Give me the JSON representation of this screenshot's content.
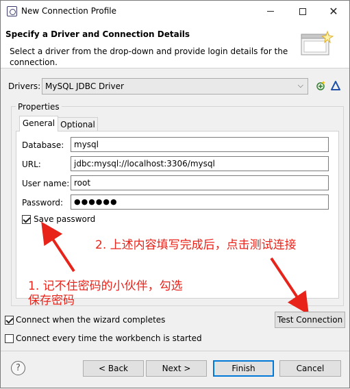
{
  "window": {
    "title": "New Connection Profile"
  },
  "header": {
    "title": "Specify a Driver and Connection Details",
    "description": "Select a driver from the drop-down and provide login details for the connection."
  },
  "drivers": {
    "label": "Drivers:",
    "selected": "MySQL JDBC Driver"
  },
  "properties": {
    "group_label": "Properties",
    "tabs": [
      {
        "label": "General"
      },
      {
        "label": "Optional"
      }
    ],
    "fields": [
      {
        "label": "Database:",
        "value": "mysql"
      },
      {
        "label": "URL:",
        "value": "jdbc:mysql://localhost:3306/mysql"
      },
      {
        "label": "User name:",
        "value": "root"
      },
      {
        "label": "Password:",
        "value": "●●●●●●"
      }
    ],
    "save_password": {
      "label": "Save password",
      "checked": true
    }
  },
  "annotations": {
    "step2": "2. 上述内容填写完成后，点击测试连接",
    "step1_line1": "1. 记不住密码的小伙伴，勾选",
    "step1_line2": "保存密码",
    "color": "#e8231a"
  },
  "options": {
    "connect_when_complete": {
      "label": "Connect when the wizard completes",
      "checked": true
    },
    "connect_every_time": {
      "label": "Connect every time the workbench is started",
      "checked": false
    },
    "test_connection": "Test Connection"
  },
  "footer": {
    "back": "< Back",
    "next": "Next >",
    "finish": "Finish",
    "cancel": "Cancel"
  }
}
